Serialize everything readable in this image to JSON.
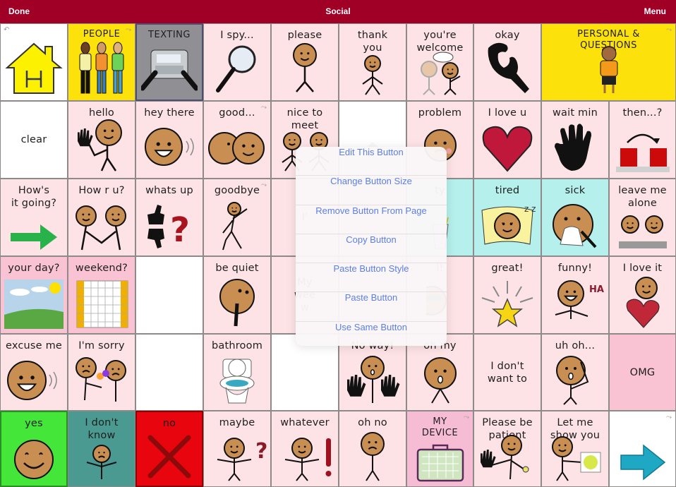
{
  "topbar": {
    "done_label": "Done",
    "title": "Social",
    "menu_label": "Menu",
    "bg": "#a10026"
  },
  "colors": {
    "pink": "#fde3e5",
    "pink_dark": "#f9c3d4",
    "white": "#ffffff",
    "yellow": "#fde10b",
    "gray": "#8f8f94",
    "teal": "#b5f0ec",
    "green": "#45e63a",
    "teal_dark": "#4a9a92",
    "red": "#e8050d",
    "device_pink": "#f6bcd3",
    "menu_text": "#5b7fe6"
  },
  "grid": {
    "rows": [
      [
        {
          "label": "",
          "icon": "home-icon",
          "bg": "white",
          "corner": "back-icon"
        },
        {
          "label": "PEOPLE",
          "icon": "people-icon",
          "bg": "yellow",
          "caps": true,
          "corner": "link-icon"
        },
        {
          "label": "TEXTING",
          "icon": "texting-phone-icon",
          "bg": "gray",
          "caps": true
        },
        {
          "label": "I spy...",
          "icon": "magnifier-icon",
          "bg": "pink"
        },
        {
          "label": "please",
          "icon": "please-person-icon",
          "bg": "pink"
        },
        {
          "label": "thank\nyou",
          "icon": "thank-you-person-icon",
          "bg": "pink"
        },
        {
          "label": "you're\nwelcome",
          "icon": "welcome-people-icon",
          "bg": "pink"
        },
        {
          "label": "okay",
          "icon": "ok-hand-icon",
          "bg": "pink"
        },
        {
          "label": "PERSONAL &\nQUESTIONS",
          "icon": "boy-icon",
          "bg": "yellow",
          "caps": true,
          "wide": true,
          "corner": "link-icon"
        }
      ],
      [
        {
          "label": "clear",
          "bg": "white",
          "center": true
        },
        {
          "label": "hello",
          "icon": "waving-person-icon",
          "bg": "pink"
        },
        {
          "label": "hey there",
          "icon": "smiling-face-icon",
          "bg": "pink"
        },
        {
          "label": "good...",
          "icon": "kiss-faces-icon",
          "bg": "pink",
          "corner": "link-icon"
        },
        {
          "label": "nice to\nmeet",
          "icon": "two-people-icon",
          "bg": "pink"
        },
        {
          "label": "",
          "bg": "white"
        },
        {
          "label": "problem",
          "icon": "worried-face-icon",
          "bg": "pink"
        },
        {
          "label": "I love u",
          "icon": "heart-icon",
          "bg": "pink"
        },
        {
          "label": "wait min",
          "icon": "hand-stop-icon",
          "bg": "pink"
        },
        {
          "label": "then...?",
          "icon": "then-blocks-icon",
          "bg": "pink"
        }
      ],
      [
        {
          "label": "How's\nit going?",
          "icon": "green-arrow-icon",
          "bg": "pink"
        },
        {
          "label": "How r u?",
          "icon": "handshake-icon",
          "bg": "pink"
        },
        {
          "label": "whats up",
          "icon": "thumbs-question-icon",
          "bg": "pink"
        },
        {
          "label": "goodbye",
          "icon": "walking-wave-icon",
          "bg": "pink",
          "corner": "link-icon"
        },
        {
          "label": "I'",
          "bg": "pink",
          "center": true
        },
        {
          "label": "",
          "bg": "pink"
        },
        {
          "label": "ty",
          "icon": "glass-icon",
          "bg": "teal"
        },
        {
          "label": "tired",
          "icon": "sleeping-icon",
          "bg": "teal"
        },
        {
          "label": "sick",
          "icon": "sick-face-icon",
          "bg": "teal"
        },
        {
          "label": "leave me\nalone",
          "icon": "leave-alone-icon",
          "bg": "pink"
        }
      ],
      [
        {
          "label": "your day?",
          "icon": "sunny-day-icon",
          "bg": "pink_dark"
        },
        {
          "label": "weekend?",
          "icon": "calendar-icon",
          "bg": "pink_dark"
        },
        {
          "label": "",
          "bg": "white"
        },
        {
          "label": "be quiet",
          "icon": "shush-face-icon",
          "bg": "pink"
        },
        {
          "label": "My\nwee\nw",
          "bg": "pink",
          "center": true
        },
        {
          "label": "",
          "bg": "pink"
        },
        {
          "label": "l!",
          "icon": "cool-face-icon",
          "bg": "pink"
        },
        {
          "label": "great!",
          "icon": "star-icon",
          "bg": "pink"
        },
        {
          "label": "funny!",
          "icon": "laughing-icon",
          "bg": "pink"
        },
        {
          "label": "I love it",
          "icon": "hug-heart-icon",
          "bg": "pink"
        }
      ],
      [
        {
          "label": "excuse me",
          "icon": "talking-face-icon",
          "bg": "pink"
        },
        {
          "label": "I'm sorry",
          "icon": "sorry-flowers-icon",
          "bg": "pink"
        },
        {
          "label": "",
          "bg": "white"
        },
        {
          "label": "bathroom",
          "icon": "toilet-icon",
          "bg": "pink"
        },
        {
          "label": "",
          "bg": "white"
        },
        {
          "label": "No way!",
          "icon": "no-way-hands-icon",
          "bg": "pink"
        },
        {
          "label": "oh my",
          "icon": "shocked-face-icon",
          "bg": "pink"
        },
        {
          "label": "I don't\nwant to",
          "bg": "pink",
          "center": true
        },
        {
          "label": "uh oh...",
          "icon": "uh-oh-icon",
          "bg": "pink"
        },
        {
          "label": "OMG",
          "bg": "pink_dark",
          "center": true
        }
      ],
      [
        {
          "label": "yes",
          "icon": "happy-face-icon",
          "bg": "green"
        },
        {
          "label": "I don't\nknow",
          "icon": "shrug-sad-icon",
          "bg": "teal_dark"
        },
        {
          "label": "no",
          "icon": "red-x-icon",
          "bg": "red"
        },
        {
          "label": "maybe",
          "icon": "maybe-shrug-icon",
          "bg": "pink"
        },
        {
          "label": "whatever",
          "icon": "whatever-shrug-icon",
          "bg": "pink"
        },
        {
          "label": "oh no",
          "icon": "sad-person-icon",
          "bg": "pink"
        },
        {
          "label": "MY\nDEVICE",
          "icon": "device-icon",
          "bg": "device_pink",
          "caps": true,
          "corner": "link-icon"
        },
        {
          "label": "Please be\npatient",
          "icon": "patient-person-icon",
          "bg": "pink"
        },
        {
          "label": "Let me\nshow you",
          "icon": "show-flower-icon",
          "bg": "pink"
        },
        {
          "label": "",
          "icon": "next-arrow-icon",
          "bg": "white",
          "corner": "link-icon"
        }
      ]
    ]
  },
  "context_menu": {
    "items": [
      "Edit This Button",
      "Change Button Size",
      "Remove Button From Page",
      "Copy Button",
      "Paste Button Style",
      "Paste Button",
      "Use Same Button"
    ]
  }
}
